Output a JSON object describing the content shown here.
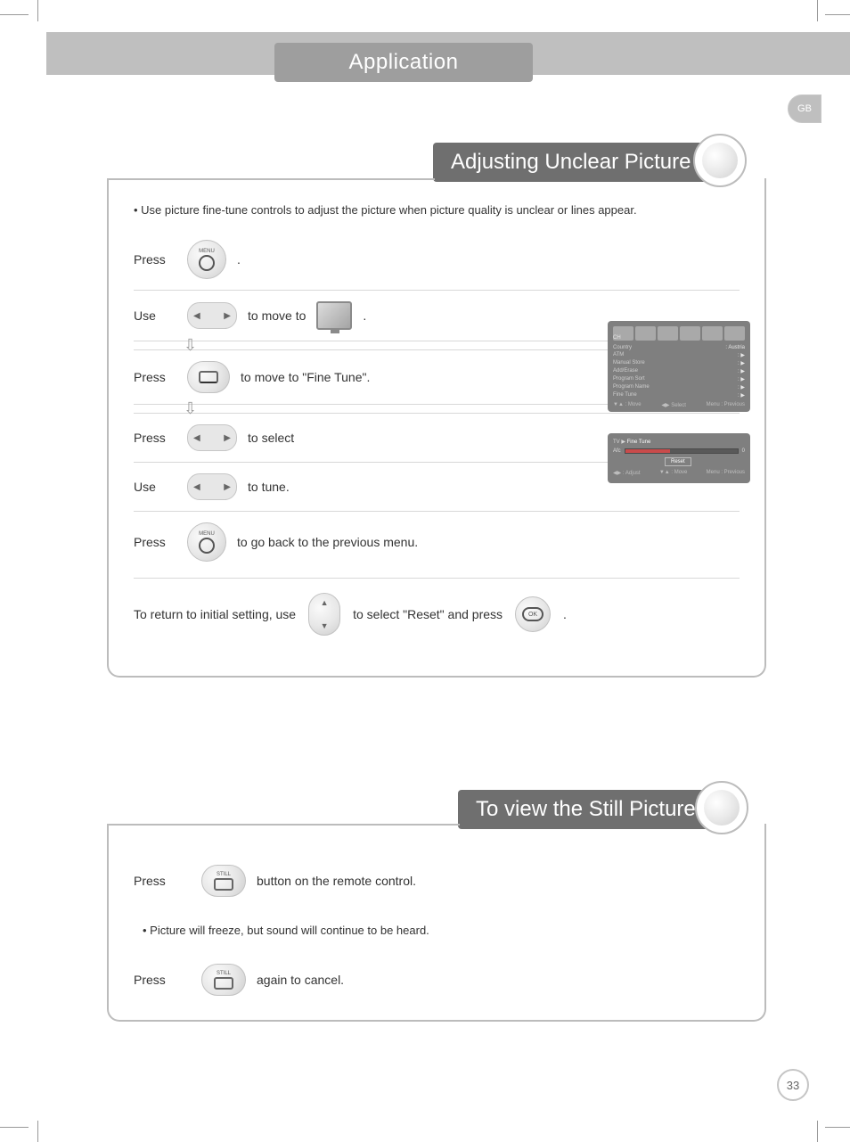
{
  "header": {
    "app_title": "Application"
  },
  "side_tab": "GB",
  "page_number": "33",
  "section1": {
    "title": "Adjusting Unclear Picture",
    "intro": "• Use picture fine-tune controls to adjust the picture when picture quality is unclear or lines appear.",
    "steps": {
      "s1": {
        "verb": "Press",
        "tail": "."
      },
      "s2": {
        "verb": "Use",
        "tail": "to move to",
        "tail2": "."
      },
      "s3": {
        "verb": "Press",
        "tail": "to move to \"Fine Tune\"."
      },
      "s4": {
        "verb": "Press",
        "tail": "to select"
      },
      "s5": {
        "verb": "Use",
        "tail": "to tune."
      },
      "s6": {
        "verb": "Press",
        "tail": "to go back to the previous menu."
      }
    },
    "reset": {
      "pre": "To return to initial setting, use",
      "mid": "to select \"Reset\" and press",
      "end": "."
    },
    "btn_labels": {
      "menu": "MENU",
      "ok": "OK"
    },
    "osd1": {
      "ch": "CH",
      "rows": {
        "country": {
          "l": "Country",
          "r": ": Austria"
        },
        "atm": {
          "l": "ATM",
          "r": ": ▶"
        },
        "manual": {
          "l": "Manual Store",
          "r": ": ▶"
        },
        "adderase": {
          "l": "Add/Erase",
          "r": ": ▶"
        },
        "sort": {
          "l": "Program Sort",
          "r": ": ▶"
        },
        "name": {
          "l": "Program Name",
          "r": ": ▶"
        },
        "fine": {
          "l": "Fine Tune",
          "r": ": ▶"
        }
      },
      "foot": {
        "move": "▼▲ : Move",
        "select": "◀▶  Select",
        "prev": "Menu : Previous"
      }
    },
    "osd2": {
      "crumb_pre": "TV ▶ ",
      "crumb_active": "Fine Tune",
      "afc": "Afc",
      "val": "0",
      "reset": "Reset",
      "foot": {
        "adjust": "◀▶ : Adjust",
        "move": "▼▲ : Move",
        "prev": "Menu : Previous"
      }
    }
  },
  "section2": {
    "title": "To view the Still Picture",
    "btn_label": "STILL",
    "s1": {
      "verb": "Press",
      "tail": "button on the remote control."
    },
    "note": "• Picture will freeze, but sound will continue to be heard.",
    "s2": {
      "verb": "Press",
      "tail": "again to cancel."
    }
  }
}
